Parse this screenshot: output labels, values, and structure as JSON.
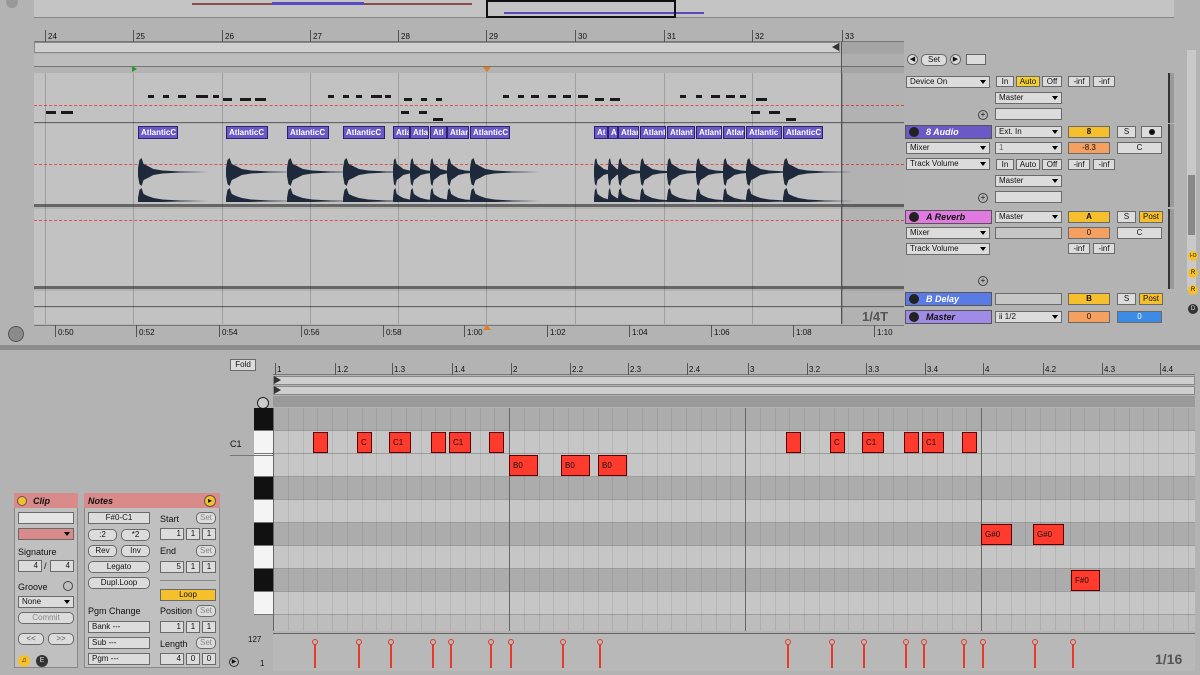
{
  "arrangement": {
    "bar_numbers": [
      "24",
      "25",
      "26",
      "27",
      "28",
      "29",
      "30",
      "31",
      "32",
      "33"
    ],
    "time_ticks": [
      "0:50",
      "0:52",
      "0:54",
      "0:56",
      "0:58",
      "1:00",
      "1:02",
      "1:04",
      "1:06",
      "1:08",
      "1:10"
    ],
    "quantize": "1/4T",
    "loop_set_label": "Set",
    "clip_name": "AtlanticC",
    "clip_names_short": [
      "Atla",
      "Atla",
      "Atl",
      "Atlar",
      "At",
      "A",
      "Atlar",
      "Atlant",
      "Atlant",
      "Atlant",
      "Atlar",
      "Atlantic"
    ],
    "master_track": {
      "device": "Device On",
      "input": "In",
      "auto": "Auto",
      "off": "Off",
      "out": "Master",
      "inf1": "-inf",
      "inf2": "-inf"
    },
    "tracks": [
      {
        "name": "8 Audio",
        "color": "#6b5ac6",
        "input": "Ext. In",
        "mixer": "Mixer",
        "channel": "1",
        "param": "Track Volume",
        "output": "Master",
        "in": "In",
        "auto": "Auto",
        "off": "Off",
        "num": "8",
        "solo": "S",
        "vol": "-8.3",
        "pan": "C",
        "inf1": "-inf",
        "inf2": "-inf"
      },
      {
        "name": "A Reverb",
        "color": "#e07ae0",
        "output": "Master",
        "mixer": "Mixer",
        "param": "Track Volume",
        "num": "A",
        "solo": "S",
        "post": "Post",
        "vol": "0",
        "pan": "C",
        "inf1": "-inf",
        "inf2": "-inf"
      },
      {
        "name": "B Delay",
        "color": "#5a7ae6",
        "num": "B",
        "solo": "S",
        "post": "Post"
      },
      {
        "name": "Master",
        "color": "#a08ce6",
        "output": "ii 1/2",
        "vol": "0",
        "vol2": "0"
      }
    ],
    "io_buttons": [
      "I-O",
      "R",
      "R",
      "D"
    ]
  },
  "clip": {
    "clip_title": "Clip",
    "notes_title": "Notes",
    "signature_label": "Signature",
    "sig_num": "4",
    "sig_den": "4",
    "groove_label": "Groove",
    "groove_value": "None",
    "commit": "Commit",
    "nav_prev": "<<",
    "nav_next": ">>",
    "note_range": "F#0-C1",
    "div2": ":2",
    "mul2": "*2",
    "rev": "Rev",
    "inv": "Inv",
    "legato": "Legato",
    "dupl": "Dupl.Loop",
    "pgm_change": "Pgm Change",
    "bank": "Bank ---",
    "sub": "Sub ---",
    "pgm": "Pgm ---",
    "start_label": "Start",
    "end_label": "End",
    "loop_label": "Loop",
    "position_label": "Position",
    "length_label": "Length",
    "set": "Set",
    "start": [
      "1",
      "1",
      "1"
    ],
    "end": [
      "5",
      "1",
      "1"
    ],
    "position": [
      "1",
      "1",
      "1"
    ],
    "length": [
      "4",
      "0",
      "0"
    ]
  },
  "editor": {
    "fold": "Fold",
    "ruler": [
      "1",
      "1.2",
      "1.3",
      "1.4",
      "2",
      "2.2",
      "2.3",
      "2.4",
      "3",
      "3.2",
      "3.3",
      "3.4",
      "4",
      "4.2",
      "4.3",
      "4.4"
    ],
    "c1_label": "C1",
    "vel_max": "127",
    "vel_min": "1",
    "grid": "1/16",
    "notes": [
      {
        "t": "",
        "row": 0
      },
      {
        "t": "C",
        "row": 0
      },
      {
        "t": "C1",
        "row": 0
      },
      {
        "t": "",
        "row": 0
      },
      {
        "t": "C1",
        "row": 0
      },
      {
        "t": "",
        "row": 0
      },
      {
        "t": "B0",
        "row": 1
      },
      {
        "t": "B0",
        "row": 1
      },
      {
        "t": "B0",
        "row": 1
      },
      {
        "t": "",
        "row": 0
      },
      {
        "t": "C",
        "row": 0
      },
      {
        "t": "C1",
        "row": 0
      },
      {
        "t": "",
        "row": 0
      },
      {
        "t": "C1",
        "row": 0
      },
      {
        "t": "",
        "row": 0
      },
      {
        "t": "G#0",
        "row": 4
      },
      {
        "t": "G#0",
        "row": 4
      },
      {
        "t": "F#0",
        "row": 6
      }
    ]
  }
}
